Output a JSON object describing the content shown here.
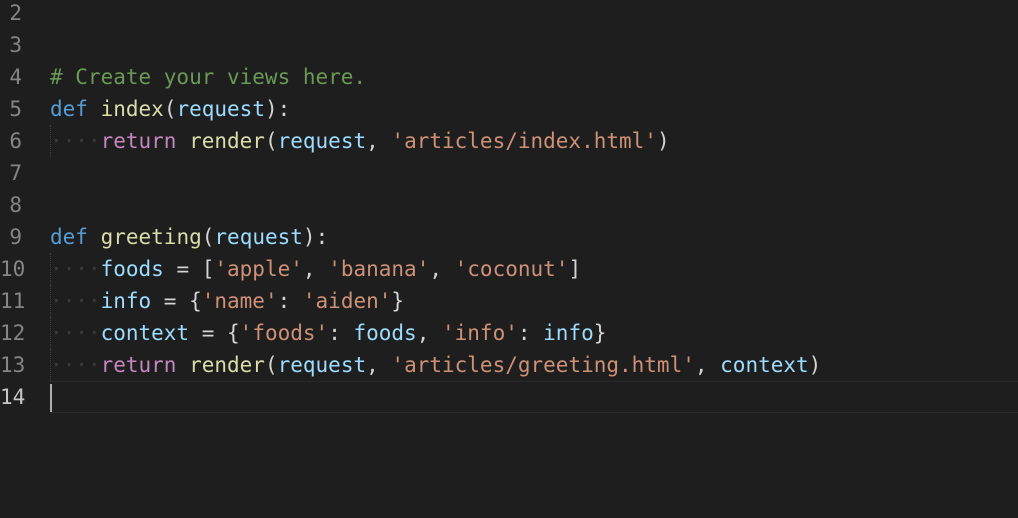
{
  "editor": {
    "lines": [
      {
        "num": "2",
        "tokens": []
      },
      {
        "num": "3",
        "tokens": []
      },
      {
        "num": "4",
        "tokens": [
          {
            "t": "# Create your views here.",
            "c": "cmt"
          }
        ]
      },
      {
        "num": "5",
        "tokens": [
          {
            "t": "def",
            "c": "kw"
          },
          {
            "t": " ",
            "c": "op"
          },
          {
            "t": "index",
            "c": "fn"
          },
          {
            "t": "(",
            "c": "op"
          },
          {
            "t": "request",
            "c": "var"
          },
          {
            "t": "):",
            "c": "op"
          }
        ]
      },
      {
        "num": "6",
        "guide": true,
        "tokens": [
          {
            "t": "····",
            "c": "ws"
          },
          {
            "t": "return",
            "c": "ctl"
          },
          {
            "t": " ",
            "c": "op"
          },
          {
            "t": "render",
            "c": "fn"
          },
          {
            "t": "(",
            "c": "op"
          },
          {
            "t": "request",
            "c": "var"
          },
          {
            "t": ", ",
            "c": "op"
          },
          {
            "t": "'articles/index.html'",
            "c": "str"
          },
          {
            "t": ")",
            "c": "op"
          }
        ]
      },
      {
        "num": "7",
        "tokens": []
      },
      {
        "num": "8",
        "tokens": []
      },
      {
        "num": "9",
        "tokens": [
          {
            "t": "def",
            "c": "kw"
          },
          {
            "t": " ",
            "c": "op"
          },
          {
            "t": "greeting",
            "c": "fn"
          },
          {
            "t": "(",
            "c": "op"
          },
          {
            "t": "request",
            "c": "var"
          },
          {
            "t": "):",
            "c": "op"
          }
        ]
      },
      {
        "num": "10",
        "guide": true,
        "tokens": [
          {
            "t": "····",
            "c": "ws"
          },
          {
            "t": "foods",
            "c": "var"
          },
          {
            "t": " = [",
            "c": "op"
          },
          {
            "t": "'apple'",
            "c": "str"
          },
          {
            "t": ", ",
            "c": "op"
          },
          {
            "t": "'banana'",
            "c": "str"
          },
          {
            "t": ", ",
            "c": "op"
          },
          {
            "t": "'coconut'",
            "c": "str"
          },
          {
            "t": "]",
            "c": "op"
          }
        ]
      },
      {
        "num": "11",
        "guide": true,
        "tokens": [
          {
            "t": "····",
            "c": "ws"
          },
          {
            "t": "info",
            "c": "var"
          },
          {
            "t": " = {",
            "c": "op"
          },
          {
            "t": "'name'",
            "c": "str"
          },
          {
            "t": ": ",
            "c": "op"
          },
          {
            "t": "'aiden'",
            "c": "str"
          },
          {
            "t": "}",
            "c": "op"
          }
        ]
      },
      {
        "num": "12",
        "guide": true,
        "tokens": [
          {
            "t": "····",
            "c": "ws"
          },
          {
            "t": "context",
            "c": "var"
          },
          {
            "t": " = {",
            "c": "op"
          },
          {
            "t": "'foods'",
            "c": "str"
          },
          {
            "t": ": ",
            "c": "op"
          },
          {
            "t": "foods",
            "c": "var"
          },
          {
            "t": ", ",
            "c": "op"
          },
          {
            "t": "'info'",
            "c": "str"
          },
          {
            "t": ": ",
            "c": "op"
          },
          {
            "t": "info",
            "c": "var"
          },
          {
            "t": "}",
            "c": "op"
          }
        ]
      },
      {
        "num": "13",
        "guide": true,
        "tokens": [
          {
            "t": "····",
            "c": "ws"
          },
          {
            "t": "return",
            "c": "ctl"
          },
          {
            "t": " ",
            "c": "op"
          },
          {
            "t": "render",
            "c": "fn"
          },
          {
            "t": "(",
            "c": "op"
          },
          {
            "t": "request",
            "c": "var"
          },
          {
            "t": ", ",
            "c": "op"
          },
          {
            "t": "'articles/greeting.html'",
            "c": "str"
          },
          {
            "t": ", ",
            "c": "op"
          },
          {
            "t": "context",
            "c": "var"
          },
          {
            "t": ")",
            "c": "op"
          }
        ]
      },
      {
        "num": "14",
        "current": true,
        "tokens": []
      }
    ]
  }
}
